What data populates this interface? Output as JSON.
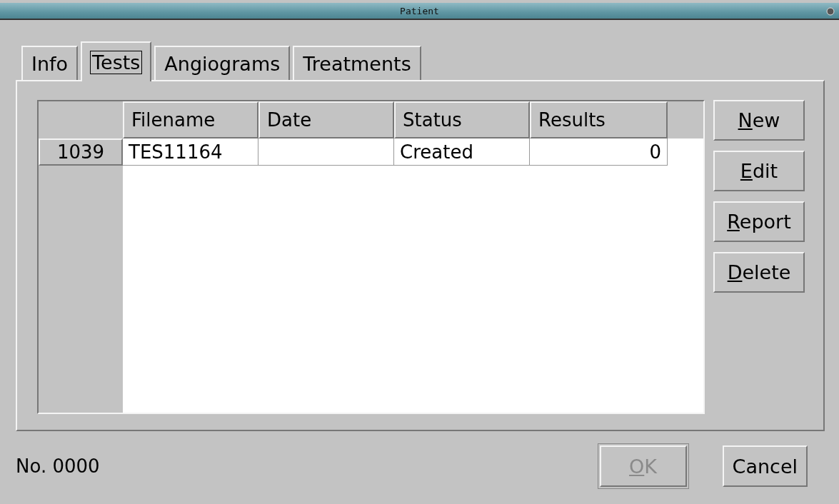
{
  "window": {
    "title": "Patient"
  },
  "tabs": [
    {
      "label": "Info",
      "selected": false
    },
    {
      "label": "Tests",
      "selected": true
    },
    {
      "label": "Angiograms",
      "selected": false
    },
    {
      "label": "Treatments",
      "selected": false
    }
  ],
  "table": {
    "columns": [
      {
        "label": "Filename"
      },
      {
        "label": "Date"
      },
      {
        "label": "Status"
      },
      {
        "label": "Results"
      }
    ],
    "rows": [
      {
        "header": "1039",
        "cells": [
          "TES11164",
          "",
          "Created",
          "0"
        ]
      }
    ]
  },
  "side_buttons": [
    {
      "label": "New",
      "mnemonic": true
    },
    {
      "label": "Edit",
      "mnemonic": true
    },
    {
      "label": "Report",
      "mnemonic": true
    },
    {
      "label": "Delete",
      "mnemonic": true
    }
  ],
  "record_number": "No. 0000",
  "dialog_buttons": [
    {
      "label": "OK",
      "mnemonic": true,
      "disabled": true
    },
    {
      "label": "Cancel",
      "mnemonic": false,
      "disabled": false
    }
  ]
}
